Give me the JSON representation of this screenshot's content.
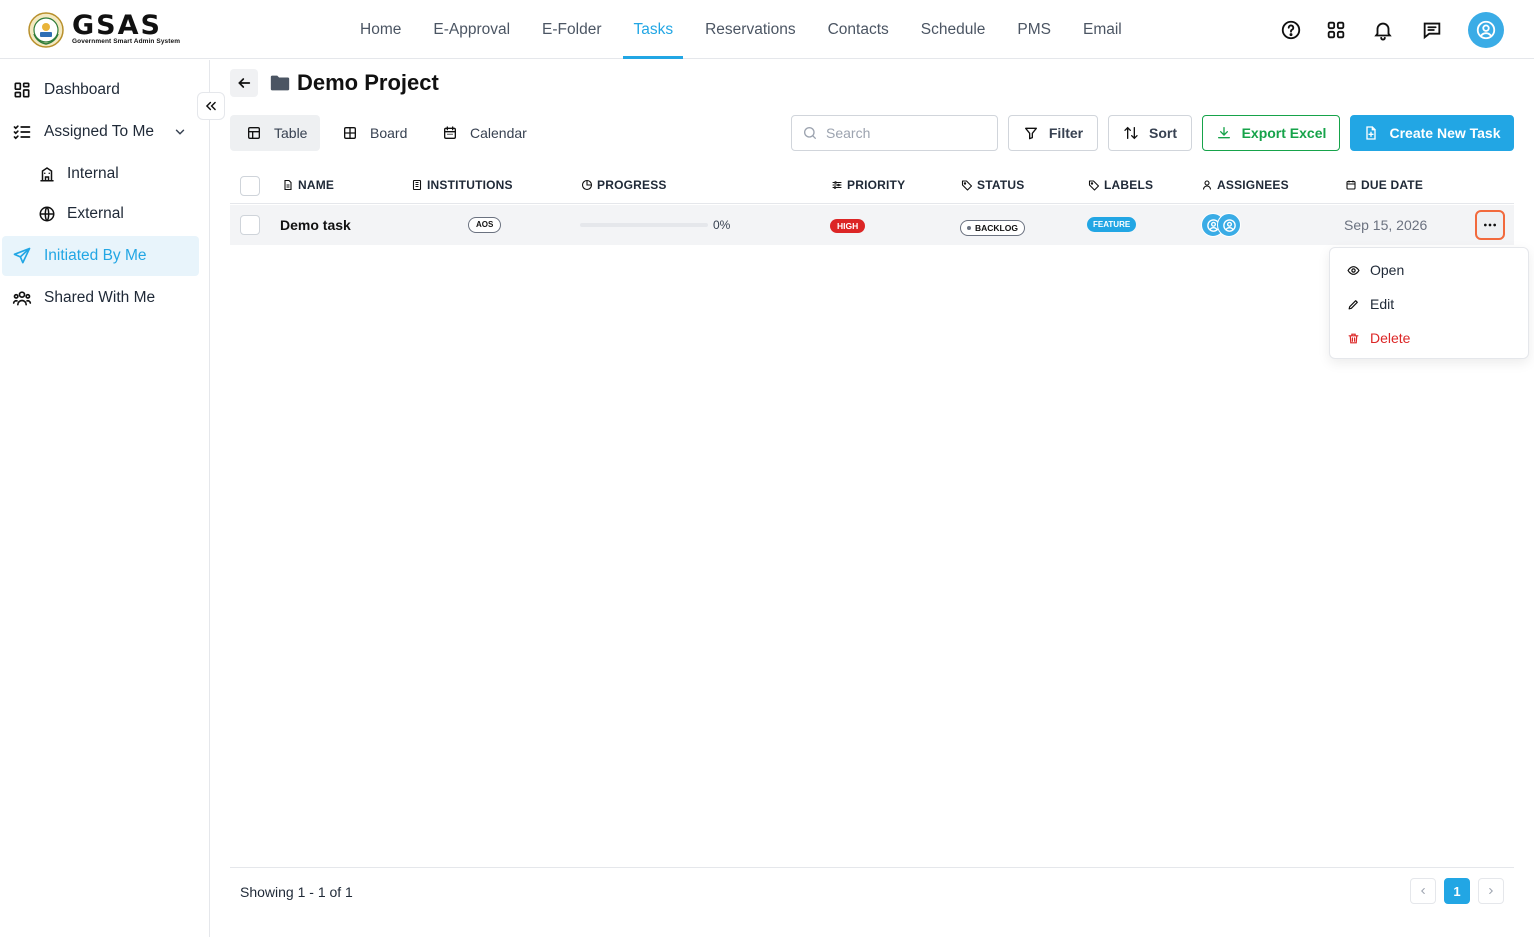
{
  "brand": {
    "name": "GSAS",
    "subtitle": "Government Smart Admin System"
  },
  "nav": {
    "links": [
      "Home",
      "E-Approval",
      "E-Folder",
      "Tasks",
      "Reservations",
      "Contacts",
      "Schedule",
      "PMS",
      "Email"
    ],
    "active": "Tasks"
  },
  "sidebar": {
    "items": [
      {
        "label": "Dashboard",
        "icon": "dashboard-grid-icon"
      },
      {
        "label": "Assigned To Me",
        "icon": "list-check-icon"
      },
      {
        "label": "Internal",
        "icon": "building-icon"
      },
      {
        "label": "External",
        "icon": "globe-icon"
      },
      {
        "label": "Initiated By Me",
        "icon": "send-icon"
      },
      {
        "label": "Shared With Me",
        "icon": "users-icon"
      }
    ],
    "active": "Initiated By Me"
  },
  "page": {
    "title": "Demo Project"
  },
  "views": {
    "table": "Table",
    "board": "Board",
    "calendar": "Calendar",
    "active": "Table"
  },
  "toolbar": {
    "search_placeholder": "Search",
    "filter": "Filter",
    "sort": "Sort",
    "export": "Export Excel",
    "create": "Create New Task"
  },
  "table": {
    "columns": [
      "NAME",
      "INSTITUTIONS",
      "PROGRESS",
      "PRIORITY",
      "STATUS",
      "LABELS",
      "ASSIGNEES",
      "DUE DATE"
    ],
    "rows": [
      {
        "name": "Demo task",
        "institution": "AOS",
        "progress_text": "0%",
        "progress": 0,
        "priority": "HIGH",
        "status": "BACKLOG",
        "label": "FEATURE",
        "assignees": 2,
        "due_date": "Sep 15, 2026"
      }
    ]
  },
  "row_menu": {
    "open": "Open",
    "edit": "Edit",
    "delete": "Delete"
  },
  "footer": {
    "showing": "Showing 1 - 1 of 1",
    "current_page": "1"
  },
  "colors": {
    "accent": "#22a6e4",
    "danger": "#dc2626",
    "success": "#16a34a",
    "focus": "#f26a3d"
  }
}
